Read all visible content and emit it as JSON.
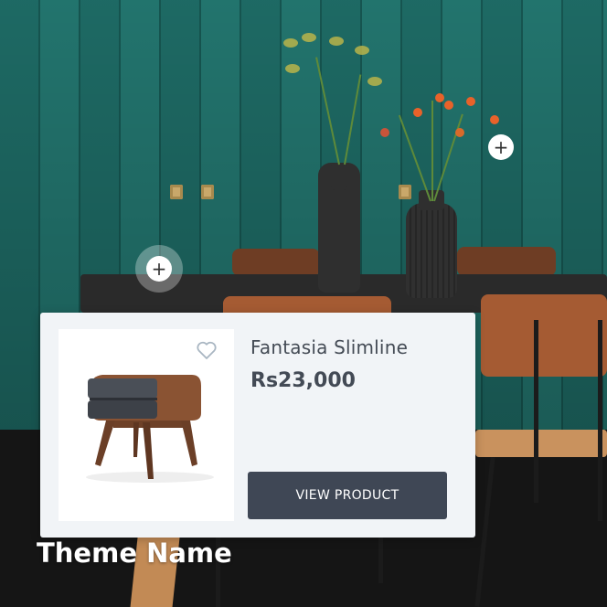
{
  "product": {
    "title": "Fantasia Slimline",
    "price": "Rs23,000",
    "cta_label": "VIEW PRODUCT",
    "favorite_icon": "heart-outline-icon"
  },
  "hotspots": [
    {
      "icon": "plus-icon",
      "label": "+"
    },
    {
      "icon": "plus-icon",
      "label": "+"
    }
  ],
  "theme": {
    "name": "Theme Name"
  },
  "colors": {
    "wall": "#1f6f69",
    "button": "#3f4755",
    "card": "#f1f4f7",
    "title_text": "#444b55"
  }
}
